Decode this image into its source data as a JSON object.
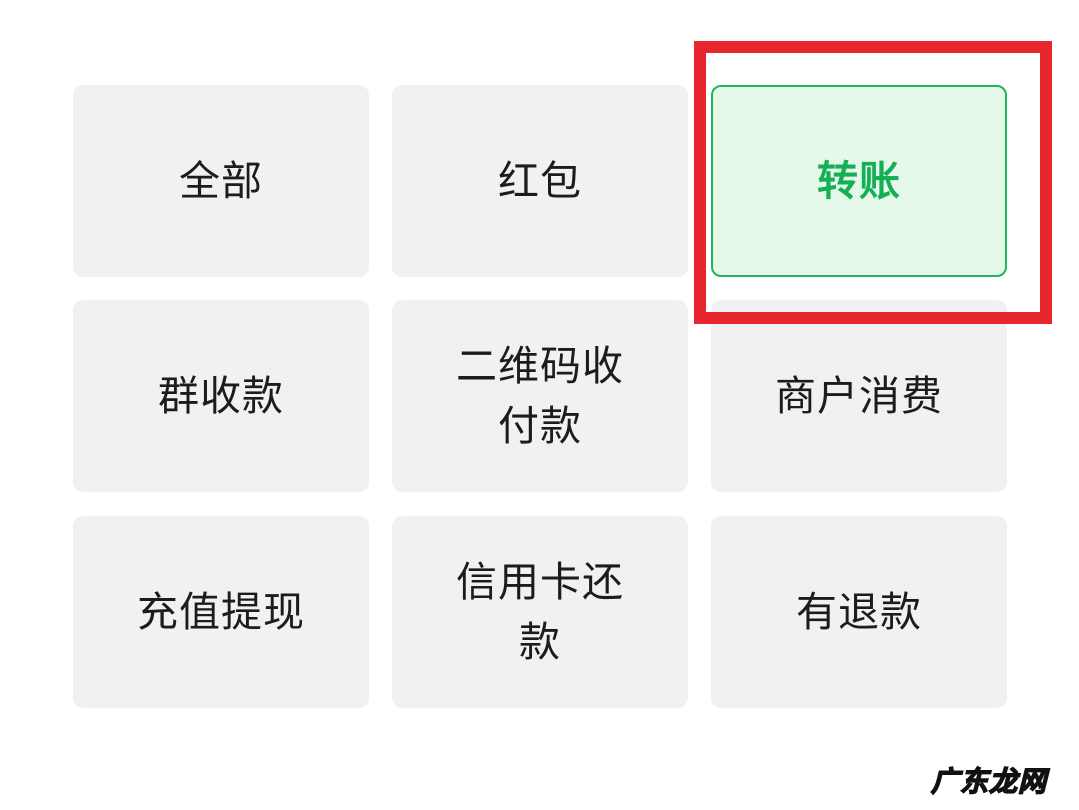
{
  "filters": [
    {
      "label": "全部",
      "selected": false
    },
    {
      "label": "红包",
      "selected": false
    },
    {
      "label": "转账",
      "selected": true
    },
    {
      "label": "群收款",
      "selected": false
    },
    {
      "label": "二维码收付款",
      "selected": false
    },
    {
      "label": "商户消费",
      "selected": false
    },
    {
      "label": "充值提现",
      "selected": false
    },
    {
      "label": "信用卡还款",
      "selected": false
    },
    {
      "label": "有退款",
      "selected": false
    }
  ],
  "watermark": "广东龙网",
  "colors": {
    "tile_bg": "#f1f1f1",
    "selected_bg": "#e6f8ea",
    "selected_accent": "#1fb55a",
    "highlight": "#e8262e"
  }
}
